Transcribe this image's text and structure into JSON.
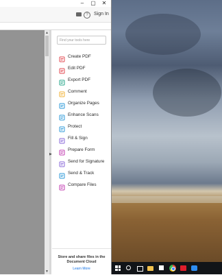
{
  "window": {
    "controls": {
      "minimize": "–",
      "maximize": "▢",
      "close": "✕"
    }
  },
  "menubar": {
    "help_glyph": "?",
    "signin_label": "Sign In"
  },
  "scroll": {
    "up": "▲",
    "down": "▼"
  },
  "collapse_arrow": "▶",
  "tools_pane": {
    "search_placeholder": "Find your tools here",
    "tools": [
      {
        "label": "Create PDF",
        "icon": "create-pdf-icon",
        "color": "#e34850"
      },
      {
        "label": "Edit PDF",
        "icon": "edit-pdf-icon",
        "color": "#e34850"
      },
      {
        "label": "Export PDF",
        "icon": "export-pdf-icon",
        "color": "#26a68a"
      },
      {
        "label": "Comment",
        "icon": "comment-icon",
        "color": "#f2b233"
      },
      {
        "label": "Organize Pages",
        "icon": "organize-pages-icon",
        "color": "#2d9ad8"
      },
      {
        "label": "Enhance Scans",
        "icon": "enhance-scans-icon",
        "color": "#2d9ad8"
      },
      {
        "label": "Protect",
        "icon": "protect-icon",
        "color": "#2d9ad8"
      },
      {
        "label": "Fill & Sign",
        "icon": "fill-sign-icon",
        "color": "#8a6ad8"
      },
      {
        "label": "Prepare Form",
        "icon": "prepare-form-icon",
        "color": "#c13bb0"
      },
      {
        "label": "Send for Signature",
        "icon": "send-for-signature-icon",
        "color": "#8a6ad8"
      },
      {
        "label": "Send & Track",
        "icon": "send-track-icon",
        "color": "#2d9ad8"
      },
      {
        "label": "Compare Files",
        "icon": "compare-files-icon",
        "color": "#c13bb0"
      }
    ],
    "promo_text": "Store and share files in the Document Cloud",
    "promo_link": "Learn More"
  },
  "taskbar": {
    "items": [
      "windows-start-icon",
      "search-icon",
      "task-view-icon",
      "file-explorer-icon",
      "store-icon",
      "chrome-icon",
      "acrobat-icon",
      "cloud-app-icon"
    ]
  }
}
